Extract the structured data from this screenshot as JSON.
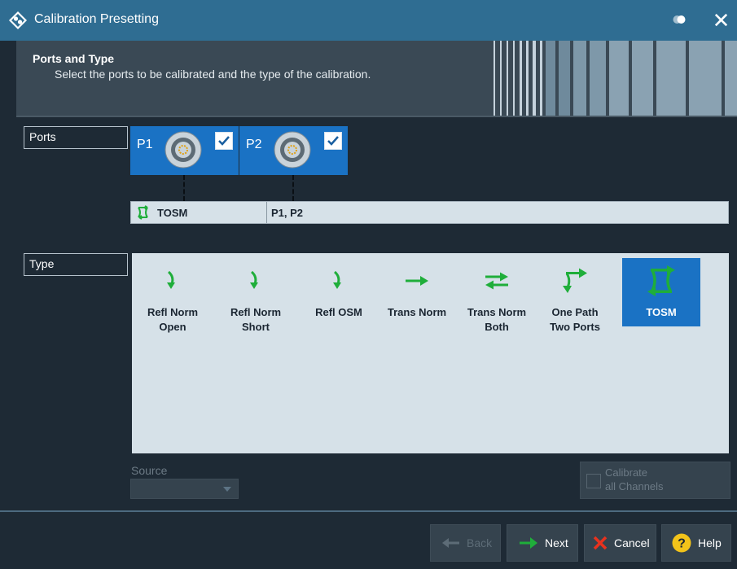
{
  "window": {
    "title": "Calibration Presetting",
    "close_label": "✕"
  },
  "header": {
    "title": "Ports and Type",
    "subtitle": "Select the ports to be calibrated and the type of the calibration."
  },
  "ports_section": {
    "label": "Ports",
    "ports": [
      {
        "name": "P1",
        "checked": true
      },
      {
        "name": "P2",
        "checked": true
      }
    ],
    "calibration_row": {
      "type": "TOSM",
      "ports": "P1, P2"
    }
  },
  "type_section": {
    "label": "Type",
    "items": [
      {
        "name": "refl-norm-open",
        "label_line1": "Refl Norm",
        "label_line2": "Open",
        "selected": false
      },
      {
        "name": "refl-norm-short",
        "label_line1": "Refl Norm",
        "label_line2": "Short",
        "selected": false
      },
      {
        "name": "refl-osm",
        "label_line1": "Refl OSM",
        "label_line2": "",
        "selected": false
      },
      {
        "name": "trans-norm",
        "label_line1": "Trans Norm",
        "label_line2": "",
        "selected": false
      },
      {
        "name": "trans-norm-both",
        "label_line1": "Trans Norm",
        "label_line2": "Both",
        "selected": false
      },
      {
        "name": "one-path-two-ports",
        "label_line1": "One Path",
        "label_line2": "Two Ports",
        "selected": false
      },
      {
        "name": "tosm",
        "label_line1": "TOSM",
        "label_line2": "",
        "selected": true
      }
    ]
  },
  "source": {
    "label": "Source",
    "value": ""
  },
  "calibrate_all": {
    "line1": "Calibrate",
    "line2": "all Channels",
    "checked": false
  },
  "footer": {
    "back_label": "Back",
    "next_label": "Next",
    "cancel_label": "Cancel",
    "help_label": "Help"
  },
  "colors": {
    "titlebar": "#2f6d92",
    "accent_blue": "#1a72c4",
    "green": "#1fae3a",
    "panel": "#d6e1e8",
    "cancel_red": "#e8321e",
    "help_yellow": "#f2c31a"
  }
}
